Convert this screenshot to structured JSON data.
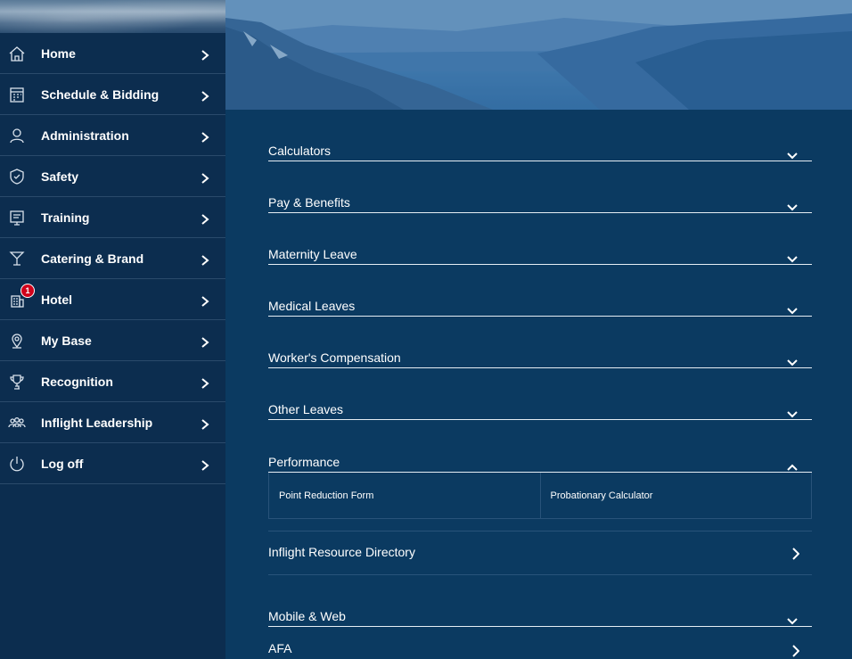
{
  "sidebar": {
    "items": [
      {
        "label": "Home",
        "icon": "home-icon"
      },
      {
        "label": "Schedule & Bidding",
        "icon": "calendar-icon"
      },
      {
        "label": "Administration",
        "icon": "person-icon"
      },
      {
        "label": "Safety",
        "icon": "shield-icon"
      },
      {
        "label": "Training",
        "icon": "presentation-icon"
      },
      {
        "label": "Catering & Brand",
        "icon": "cocktail-icon"
      },
      {
        "label": "Hotel",
        "icon": "hotel-icon",
        "badge": "1"
      },
      {
        "label": "My Base",
        "icon": "location-pin-icon"
      },
      {
        "label": "Recognition",
        "icon": "trophy-icon"
      },
      {
        "label": "Inflight Leadership",
        "icon": "group-icon"
      },
      {
        "label": "Log off",
        "icon": "power-icon"
      }
    ]
  },
  "main": {
    "sections": [
      {
        "title": "Calculators",
        "state": "collapsed"
      },
      {
        "title": "Pay & Benefits",
        "state": "collapsed"
      },
      {
        "title": "Maternity Leave",
        "state": "collapsed"
      },
      {
        "title": "Medical Leaves",
        "state": "collapsed"
      },
      {
        "title": "Worker's Compensation",
        "state": "collapsed"
      },
      {
        "title": "Other Leaves",
        "state": "collapsed"
      },
      {
        "title": "Performance",
        "state": "expanded",
        "children": [
          "Point Reduction Form",
          "Probationary Calculator"
        ]
      },
      {
        "title": "Inflight Resource Directory",
        "state": "link"
      },
      {
        "title": "Mobile & Web",
        "state": "collapsed"
      },
      {
        "title": "AFA",
        "state": "link"
      }
    ]
  },
  "colors": {
    "sidebar_bg": "#0c2d4f",
    "main_bg": "#0b3a61",
    "badge": "#d0021b"
  }
}
